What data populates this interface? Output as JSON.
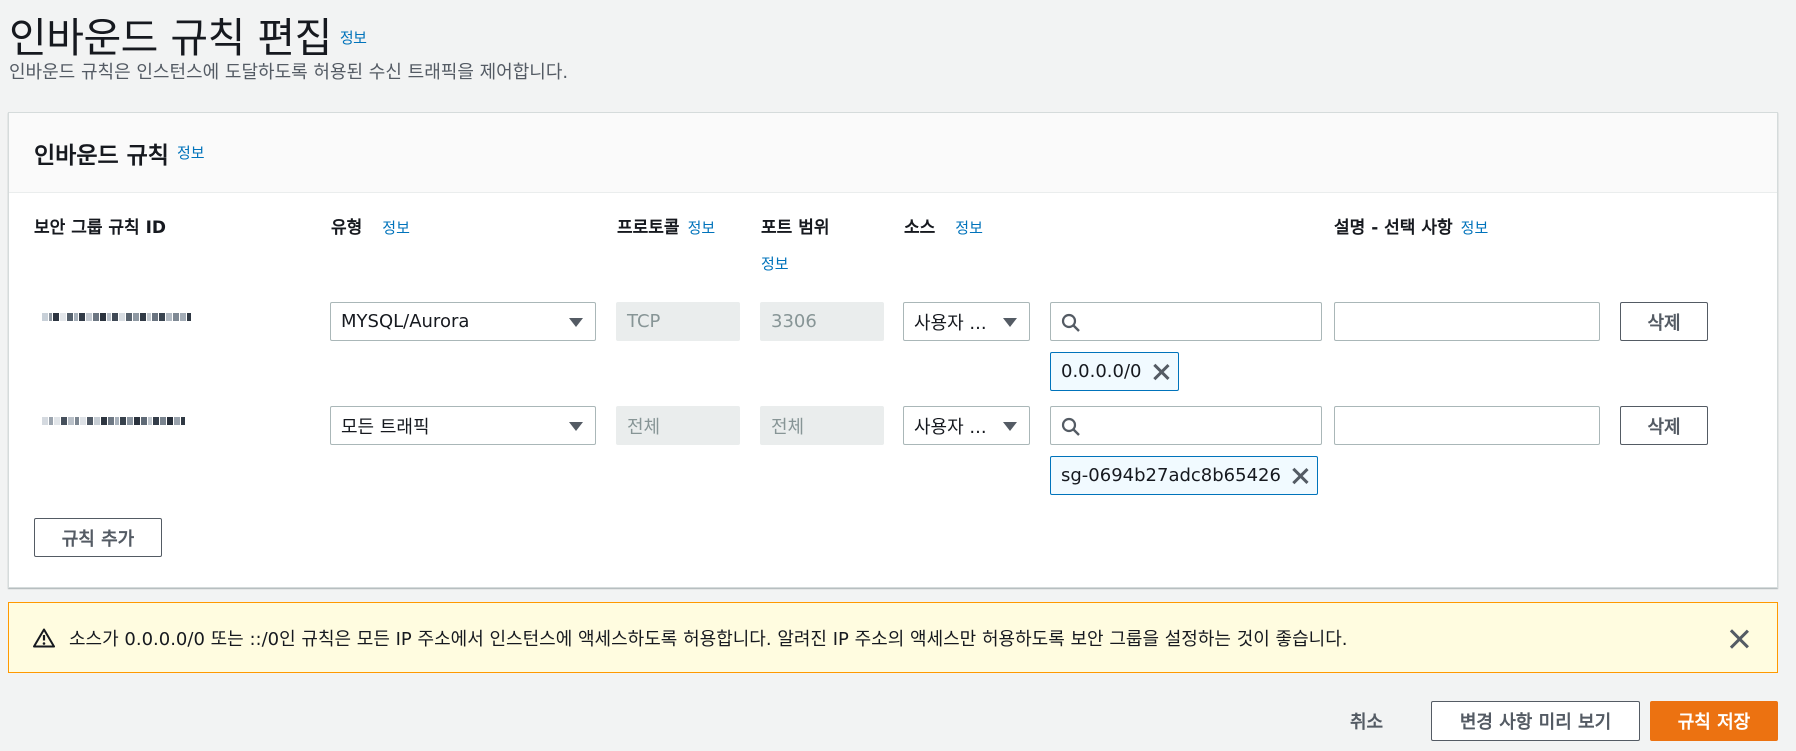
{
  "page": {
    "title": "인바운드 규칙 편집",
    "title_info": "정보",
    "description": "인바운드 규칙은 인스턴스에 도달하도록 허용된 수신 트래픽을 제어합니다."
  },
  "panel": {
    "title": "인바운드 규칙",
    "info": "정보",
    "columns": {
      "rule_id": "보안 그룹 규칙 ID",
      "type": "유형",
      "type_info": "정보",
      "protocol": "프로토콜",
      "protocol_info": "정보",
      "port_range": "포트 범위",
      "port_info": "정보",
      "source": "소스",
      "source_info": "정보",
      "description": "설명 - 선택 사항",
      "description_info": "정보"
    },
    "rules": [
      {
        "type": "MYSQL/Aurora",
        "protocol": "TCP",
        "port_range": "3306",
        "source_type": "사용자 ...",
        "source_token": "0.0.0.0/0",
        "delete_label": "삭제"
      },
      {
        "type": "모든 트래픽",
        "protocol": "전체",
        "port_range": "전체",
        "source_type": "사용자 ...",
        "source_token": "sg-0694b27adc8b65426",
        "delete_label": "삭제"
      }
    ],
    "add_rule_label": "규칙 추가"
  },
  "alert": {
    "text": "소스가 0.0.0.0/0 또는 ::/0인 규칙은 모든 IP 주소에서 인스턴스에 액세스하도록 허용합니다. 알려진 IP 주소의 액세스만 허용하도록 보안 그룹을 설정하는 것이 좋습니다.",
    "icon": "warning-icon"
  },
  "footer": {
    "cancel_label": "취소",
    "preview_label": "변경 사항 미리 보기",
    "save_label": "규칙 저장"
  },
  "colors": {
    "link": "#0073bb",
    "primary": "#ec7211",
    "alert_bg": "#fffce0",
    "alert_border": "#ff9900"
  }
}
